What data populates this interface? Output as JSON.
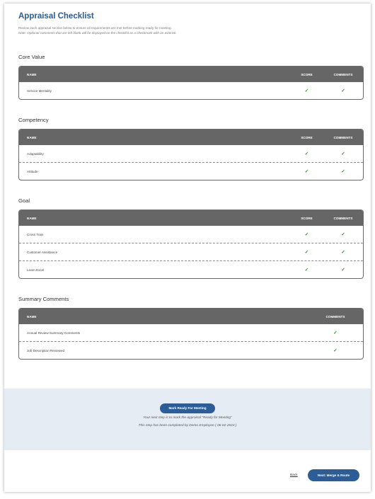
{
  "header": {
    "title": "Appraisal Checklist",
    "instruction": "Review each appraisal section below to ensure all requirements are met before marking ready for meeting.",
    "note": "Note: Optional comments that are left blank will be displayed on the checklist as a checkmark with an asterisk."
  },
  "columns": {
    "name": "NAME",
    "score": "SCORE",
    "comments": "COMMENTS"
  },
  "check_glyph": "✓",
  "check_color": "#2e8b2e",
  "sections": [
    {
      "title": "Core Value",
      "rows": [
        {
          "name": "Service Mentality"
        }
      ]
    },
    {
      "title": "Competency",
      "rows": [
        {
          "name": "Adaptability"
        },
        {
          "name": "Attitude"
        }
      ]
    },
    {
      "title": "Goal",
      "rows": [
        {
          "name": "Cross Train"
        },
        {
          "name": "Customer Assistance"
        },
        {
          "name": "Learn Excel"
        }
      ]
    },
    {
      "title": "Summary Comments",
      "rows": [
        {
          "name": "Annual Review Summary Comments"
        },
        {
          "name": "Job Description Reviewed"
        }
      ]
    }
  ],
  "footer": {
    "ready_button": "Mark Ready For Meeting",
    "next_step": "Your next step is to mark the appraisal \"Ready for Meeting\"",
    "completed": "This step has been completed by Demo Employee ( 06-02-2024 )",
    "back_link": "Back",
    "next_button": "Next: Merge & Route"
  }
}
